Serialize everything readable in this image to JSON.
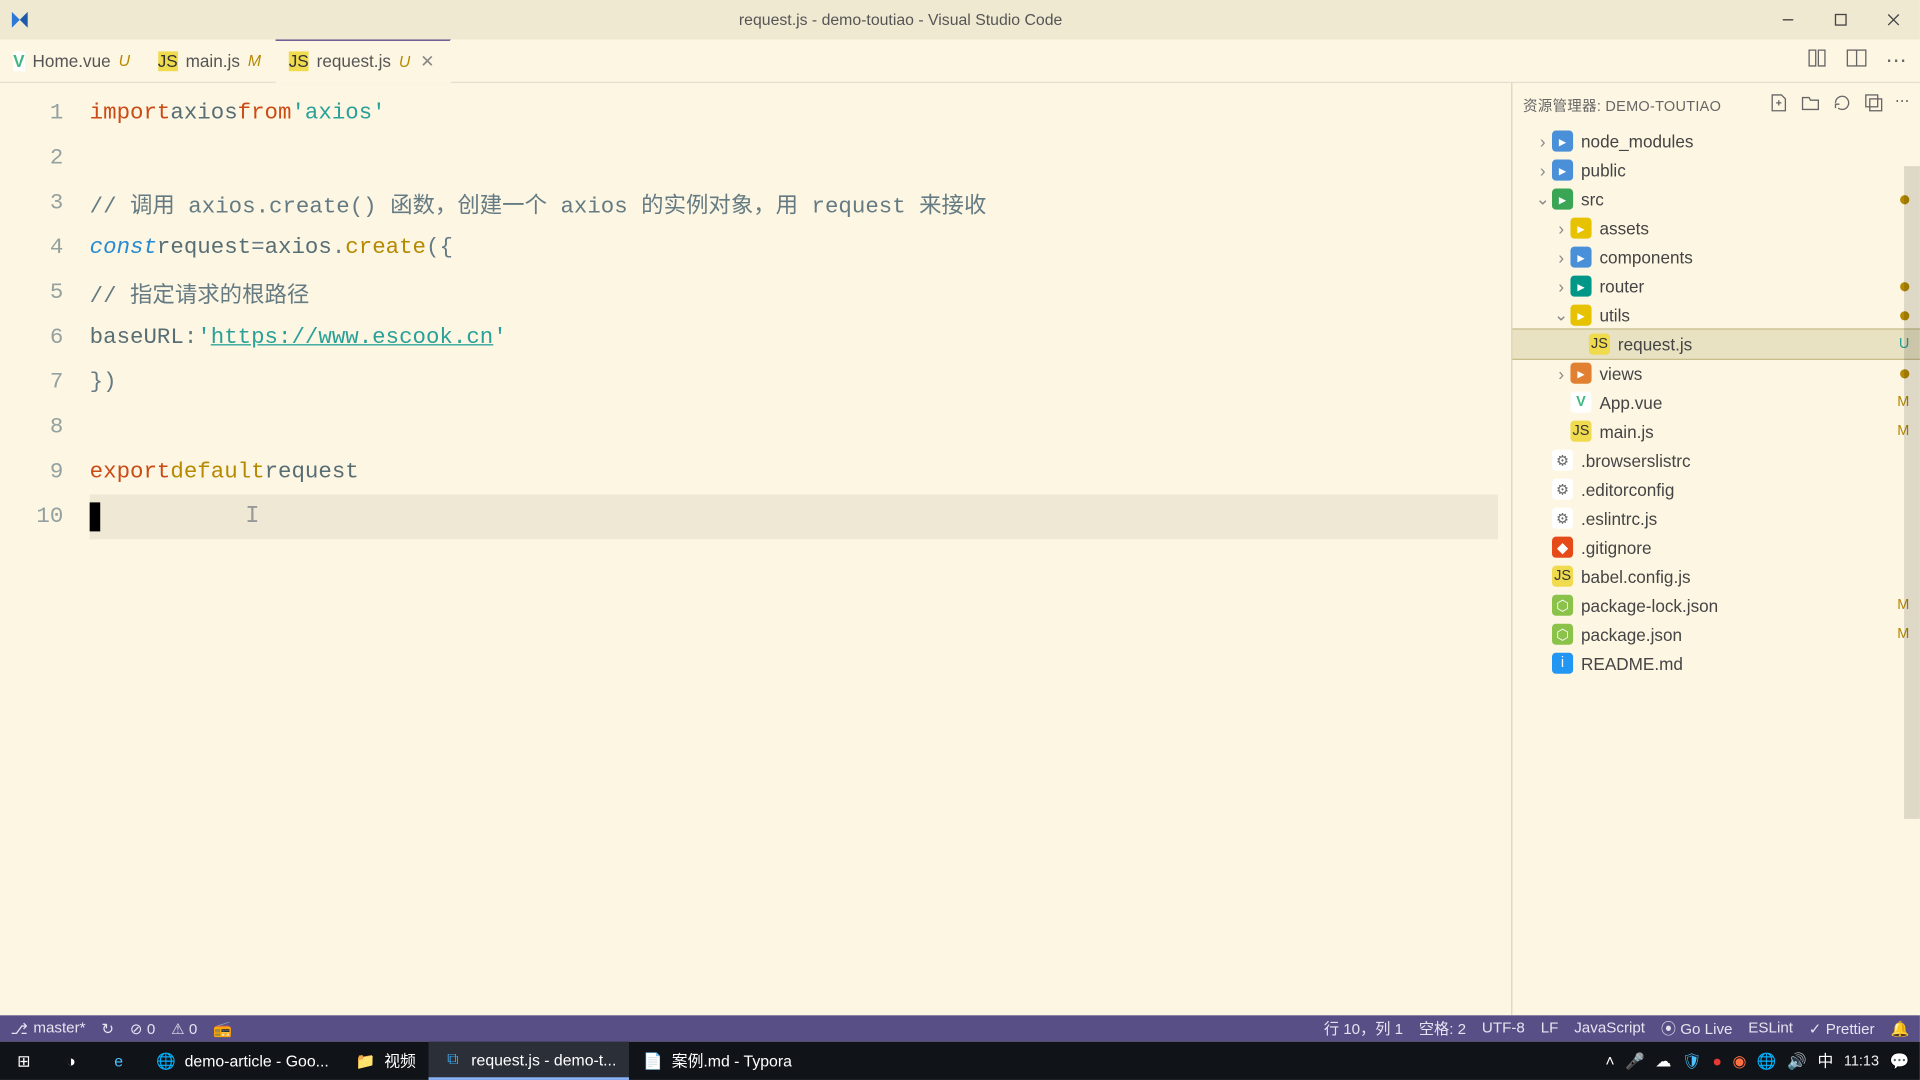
{
  "window": {
    "title": "request.js - demo-toutiao - Visual Studio Code"
  },
  "tabs": [
    {
      "name": "Home.vue",
      "badge": "U",
      "icon": "vue",
      "active": false
    },
    {
      "name": "main.js",
      "badge": "M",
      "icon": "js",
      "active": false
    },
    {
      "name": "request.js",
      "badge": "U",
      "icon": "js",
      "active": true
    }
  ],
  "code": {
    "lines": [
      {
        "n": "1",
        "html": "<span class='k-import'>import</span> <span class='id'>axios</span> <span class='k-from'>from</span> <span class='str'>'axios'</span>"
      },
      {
        "n": "2",
        "html": ""
      },
      {
        "n": "3",
        "html": "<span class='com'>// 调用 axios.create() 函数，创建一个 axios 的实例对象，用 request 来接收</span>"
      },
      {
        "n": "4",
        "html": "<span class='k-const'>const</span> <span class='id'>request</span> <span class='pun'>=</span> <span class='id'>axios</span><span class='pun'>.</span><span class='fn'>create</span><span class='pun'>({</span>"
      },
      {
        "n": "5",
        "html": "  <span class='com'>// 指定请求的根路径</span>"
      },
      {
        "n": "6",
        "html": "  <span class='id'>baseURL</span><span class='pun'>:</span> <span class='str'>'<a class='url'>https://www.escook.cn</a>'</span>"
      },
      {
        "n": "7",
        "html": "<span class='pun'>})</span>"
      },
      {
        "n": "8",
        "html": ""
      },
      {
        "n": "9",
        "html": "<span class='k-export'>export</span> <span class='k-default'>default</span> <span class='id'>request</span>"
      },
      {
        "n": "10",
        "html": "<span class='cursor-blk'></span><span class='text-caret'>I</span>",
        "current": true
      }
    ]
  },
  "explorer": {
    "title": "资源管理器: DEMO-TOUTIAO",
    "tree": [
      {
        "d": 1,
        "chev": "r",
        "icon": "folder",
        "name": "node_modules"
      },
      {
        "d": 1,
        "chev": "r",
        "icon": "folder",
        "name": "public"
      },
      {
        "d": 1,
        "chev": "d",
        "icon": "folder-g",
        "name": "src",
        "dot": true
      },
      {
        "d": 2,
        "chev": "r",
        "icon": "folder-y",
        "name": "assets"
      },
      {
        "d": 2,
        "chev": "r",
        "icon": "folder",
        "name": "components"
      },
      {
        "d": 2,
        "chev": "r",
        "icon": "folder-t",
        "name": "router",
        "dot": true
      },
      {
        "d": 2,
        "chev": "d",
        "icon": "folder-y",
        "name": "utils",
        "dot": true
      },
      {
        "d": 3,
        "icon": "js",
        "name": "request.js",
        "badge": "U",
        "active": true
      },
      {
        "d": 2,
        "chev": "r",
        "icon": "folder-o",
        "name": "views",
        "dot": true
      },
      {
        "d": 2,
        "icon": "vue",
        "name": "App.vue",
        "badge": "M"
      },
      {
        "d": 2,
        "icon": "js",
        "name": "main.js",
        "badge": "M"
      },
      {
        "d": 1,
        "icon": "conf",
        "name": ".browserslistrc"
      },
      {
        "d": 1,
        "icon": "conf",
        "name": ".editorconfig"
      },
      {
        "d": 1,
        "icon": "conf",
        "name": ".eslintrc.js"
      },
      {
        "d": 1,
        "icon": "git",
        "name": ".gitignore"
      },
      {
        "d": 1,
        "icon": "js",
        "name": "babel.config.js"
      },
      {
        "d": 1,
        "icon": "pkg",
        "name": "package-lock.json",
        "badge": "M"
      },
      {
        "d": 1,
        "icon": "pkg",
        "name": "package.json",
        "badge": "M"
      },
      {
        "d": 1,
        "icon": "info",
        "name": "README.md"
      }
    ]
  },
  "status": {
    "branch": "master*",
    "sync": "↻",
    "errors": "⊘ 0",
    "warnings": "⚠ 0",
    "radio": "📻",
    "pos": "行 10，列 1",
    "spaces": "空格: 2",
    "enc": "UTF-8",
    "eol": "LF",
    "lang": "JavaScript",
    "golive": "⦿ Go Live",
    "eslint": "ESLint",
    "prettier": "✓ Prettier",
    "bell": "🔔"
  },
  "taskbar": {
    "items": [
      {
        "label": "demo-article - Goo...",
        "icon": "chrome"
      },
      {
        "label": "视频",
        "icon": "folder"
      },
      {
        "label": "request.js - demo-t...",
        "icon": "vscode",
        "active": true
      },
      {
        "label": "案例.md - Typora",
        "icon": "typora"
      }
    ],
    "ime": "中",
    "time": "11:13"
  }
}
